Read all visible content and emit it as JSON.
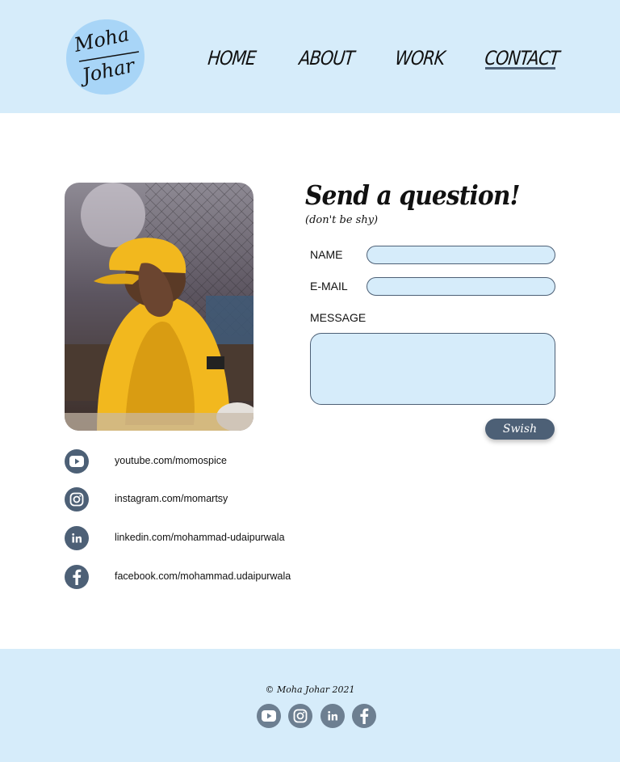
{
  "header": {
    "logo": {
      "line1": "Moha",
      "line2": "Johar",
      "icon": "signature-logo"
    },
    "nav": [
      {
        "label": "HOME"
      },
      {
        "label": "ABOUT"
      },
      {
        "label": "WORK"
      },
      {
        "label": "CONTACT",
        "active": true
      }
    ]
  },
  "photo": {
    "icon": "profile-photo"
  },
  "social": [
    {
      "icon": "youtube-icon",
      "link": "youtube.com/momospice"
    },
    {
      "icon": "instagram-icon",
      "link": "instagram.com/momartsy"
    },
    {
      "icon": "linkedin-icon",
      "link": "linkedin.com/mohammad-udaipurwala"
    },
    {
      "icon": "facebook-icon",
      "link": "facebook.com/mohammad.udaipurwala"
    }
  ],
  "form": {
    "title": "Send a question!",
    "subtitle": "(don't be shy)",
    "name_label": "NAME",
    "email_label": "E-MAIL",
    "message_label": "MESSAGE",
    "name_value": "",
    "email_value": "",
    "message_value": "",
    "submit_label": "Swish"
  },
  "footer": {
    "copyright": "© Moha Johar 2021",
    "icons": [
      "youtube-icon",
      "instagram-icon",
      "linkedin-icon",
      "facebook-icon"
    ]
  },
  "colors": {
    "header_bg": "#d6ecfa",
    "accent": "#4d6076",
    "logo_blob": "#a8d5f7",
    "footer_icon": "#6d7f91"
  }
}
